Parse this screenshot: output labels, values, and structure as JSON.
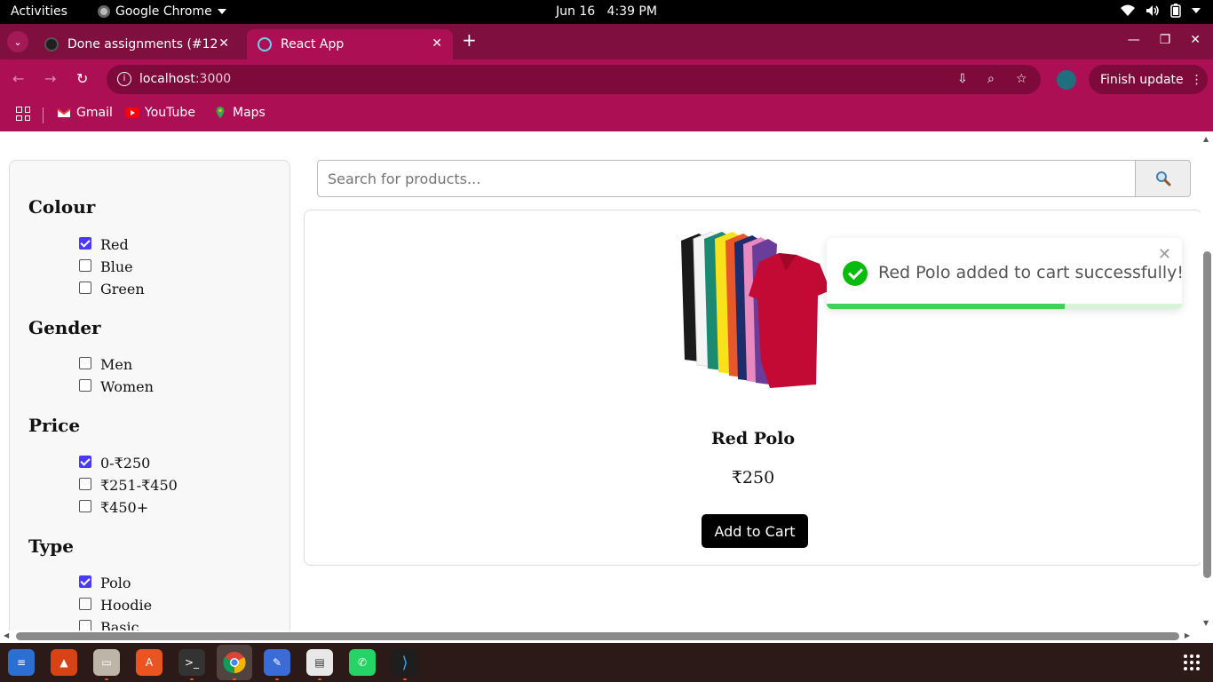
{
  "system_bar": {
    "activities": "Activities",
    "app_name": "Google Chrome",
    "date": "Jun 16",
    "time": "4:39 PM"
  },
  "browser": {
    "tabs": [
      {
        "title": "Done assignments (#12\u0000",
        "favicon": "github-icon",
        "active": false
      },
      {
        "title": "React App",
        "favicon": "react-icon",
        "active": true
      }
    ],
    "url_host": "localhost",
    "url_port": ":3000",
    "finish_update_label": "Finish update",
    "bookmarks": [
      "Gmail",
      "YouTube",
      "Maps"
    ],
    "theme_colors": {
      "frame": "#7e0f3f",
      "toolbar": "#ad0f55"
    }
  },
  "filters": {
    "groups": [
      {
        "title": "Colour",
        "options": [
          {
            "label": "Red",
            "checked": true
          },
          {
            "label": "Blue",
            "checked": false
          },
          {
            "label": "Green",
            "checked": false
          }
        ]
      },
      {
        "title": "Gender",
        "options": [
          {
            "label": "Men",
            "checked": false
          },
          {
            "label": "Women",
            "checked": false
          }
        ]
      },
      {
        "title": "Price",
        "options": [
          {
            "label": "0-₹250",
            "checked": true
          },
          {
            "label": "₹251-₹450",
            "checked": false
          },
          {
            "label": "₹450+",
            "checked": false
          }
        ]
      },
      {
        "title": "Type",
        "options": [
          {
            "label": "Polo",
            "checked": true
          },
          {
            "label": "Hoodie",
            "checked": false
          },
          {
            "label": "Basic",
            "checked": false
          }
        ]
      }
    ]
  },
  "search": {
    "placeholder": "Search for products...",
    "button_icon": "search-icon"
  },
  "product": {
    "name": "Red Polo",
    "price": "₹250",
    "add_button": "Add to Cart",
    "image": "polo-shirts-stack-image"
  },
  "toast": {
    "message": "Red Polo added to cart successfully!",
    "progress": 0.67,
    "accent": "#07bc0c"
  }
}
